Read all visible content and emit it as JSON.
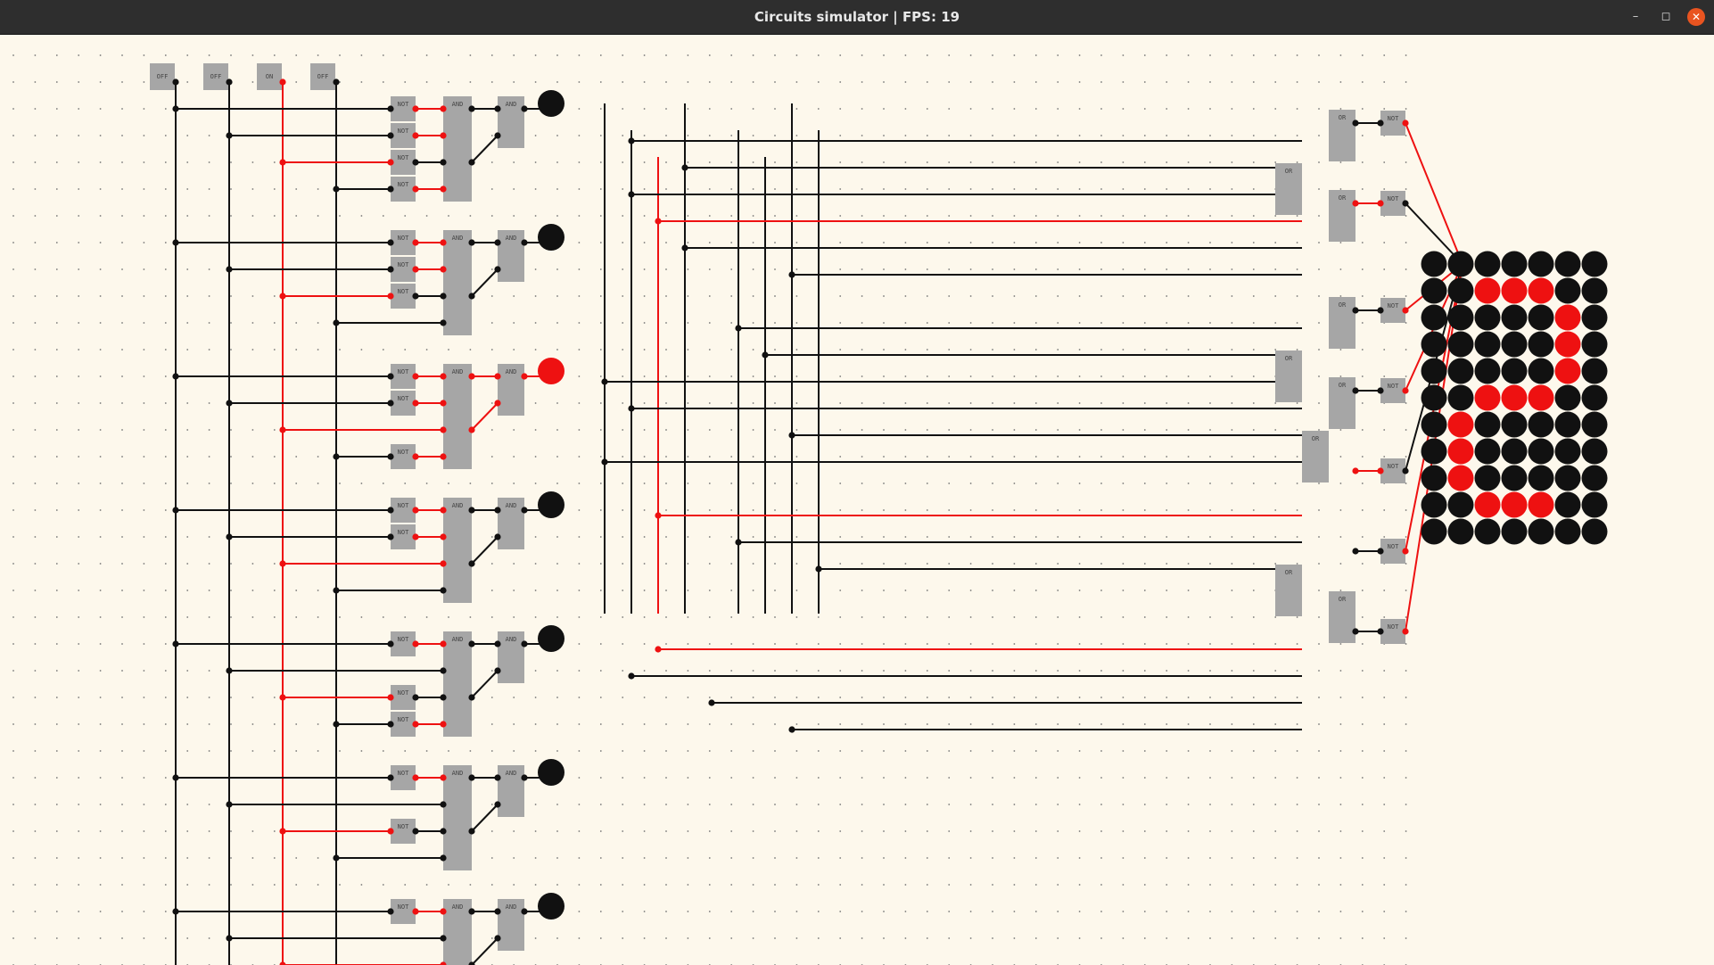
{
  "window": {
    "title": "Circuits simulator | FPS: 19",
    "controls": {
      "minimize": "–",
      "maximize": "◻",
      "close": "✕"
    }
  },
  "colors": {
    "background": "#fdf8ec",
    "titlebar": "#2e2e2e",
    "gate": "#a6a6a6",
    "wire_off": "#111111",
    "wire_on": "#ee1111",
    "close_button": "#e95420"
  },
  "inputs": [
    {
      "label": "OFF",
      "state": false
    },
    {
      "label": "OFF",
      "state": false
    },
    {
      "label": "ON",
      "state": true
    },
    {
      "label": "OFF",
      "state": false
    }
  ],
  "gate_labels": {
    "not": "NOT",
    "and": "AND",
    "or": "OR"
  },
  "decoder_lamps": [
    false,
    false,
    true,
    false,
    false,
    false,
    false,
    false
  ],
  "display_matrix": [
    [
      0,
      0,
      0,
      0,
      0,
      0,
      0
    ],
    [
      0,
      0,
      1,
      1,
      1,
      0,
      0
    ],
    [
      0,
      0,
      0,
      0,
      0,
      1,
      0
    ],
    [
      0,
      0,
      0,
      0,
      0,
      1,
      0
    ],
    [
      0,
      0,
      0,
      0,
      0,
      1,
      0
    ],
    [
      0,
      0,
      1,
      1,
      1,
      0,
      0
    ],
    [
      0,
      1,
      0,
      0,
      0,
      0,
      0
    ],
    [
      0,
      1,
      0,
      0,
      0,
      0,
      0
    ],
    [
      0,
      1,
      0,
      0,
      0,
      0,
      0
    ],
    [
      0,
      0,
      1,
      1,
      1,
      0,
      0
    ],
    [
      0,
      0,
      0,
      0,
      0,
      0,
      0
    ]
  ]
}
